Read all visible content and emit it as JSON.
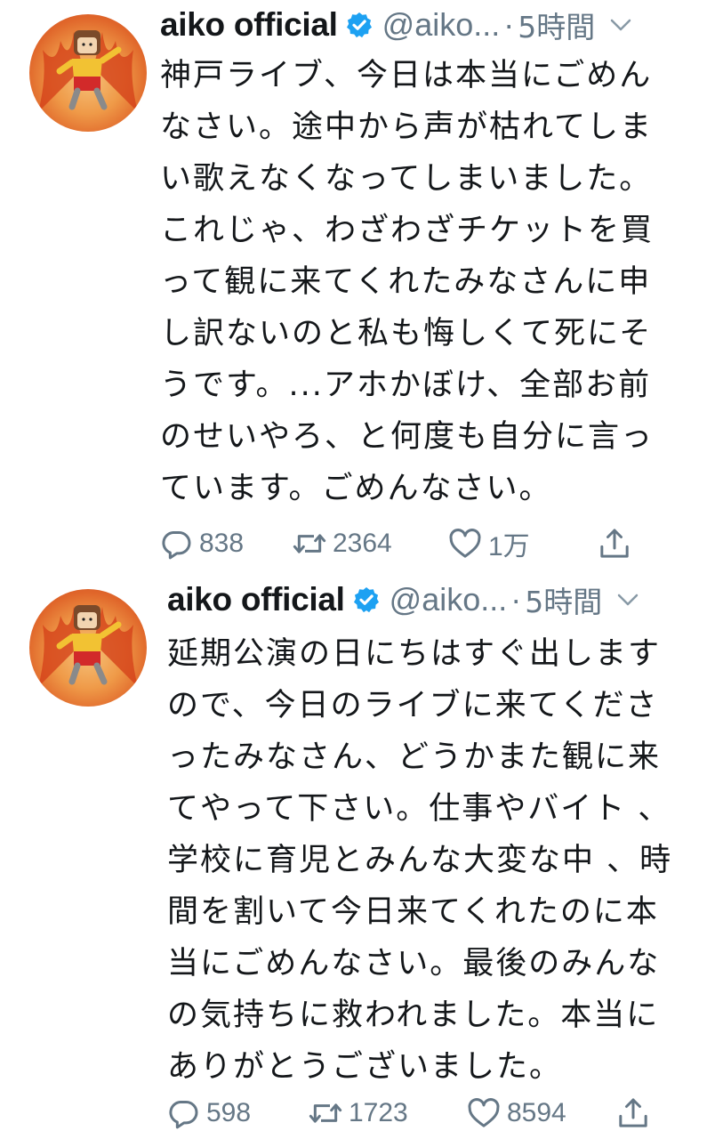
{
  "tweets": [
    {
      "display_name": "aiko official",
      "handle": "@aiko...",
      "separator": "·",
      "time": "5時間",
      "text": "神戸ライブ、今日は本当にごめん\nなさい。途中から声が枯れてしま\nい歌えなくなってしまいました。\nこれじゃ、わざわざチケットを買\nって観に来てくれたみなさんに申\nし訳ないのと私も悔しくて死にそ\nうです。...アホかぼけ、全部お前\nのせいやろ、と何度も自分に言っ\nています。ごめんなさい。",
      "replies": "838",
      "retweets": "2364",
      "likes": "1万"
    },
    {
      "display_name": "aiko official",
      "handle": "@aiko...",
      "separator": "·",
      "time": "5時間",
      "text": "延期公演の日にちはすぐ出します\nので、今日のライブに来てくださ\nったみなさん、どうかまた観に来\nてやって下さい。仕事やバイト 、\n学校に育児とみんな大変な中 、時\n間を割いて今日来てくれたのに本\n当にごめんなさい。最後のみんな\nの気持ちに救われました。本当に\nありがとうございました。",
      "replies": "598",
      "retweets": "1723",
      "likes": "8594"
    }
  ],
  "icons": {
    "verified": "verified-badge-icon",
    "caret": "chevron-down-icon",
    "reply": "reply-icon",
    "retweet": "retweet-icon",
    "like": "heart-icon",
    "share": "share-icon"
  },
  "colors": {
    "text": "#14171a",
    "secondary": "#657786",
    "verified": "#1da1f2",
    "avatar_fire": "#e0662a"
  }
}
